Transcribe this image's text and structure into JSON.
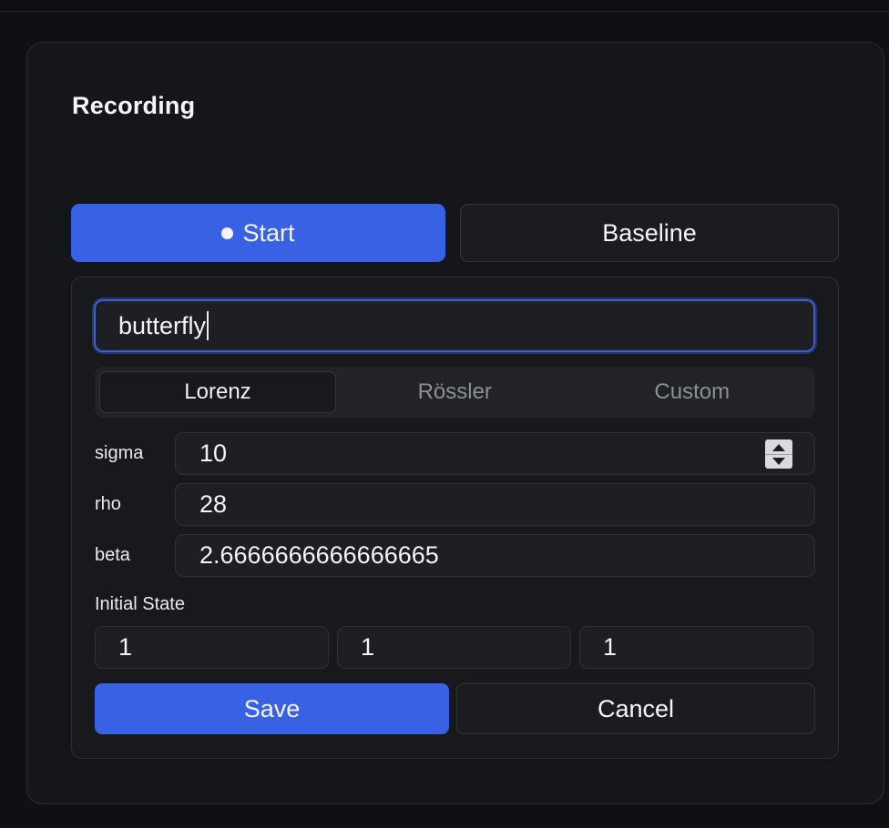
{
  "panel": {
    "title": "Recording"
  },
  "mode_buttons": {
    "start_label": "Start",
    "baseline_label": "Baseline"
  },
  "name_input": {
    "value": "butterfly"
  },
  "system_tabs": [
    {
      "label": "Lorenz",
      "active": true
    },
    {
      "label": "Rössler",
      "active": false
    },
    {
      "label": "Custom",
      "active": false
    }
  ],
  "params": [
    {
      "label": "sigma",
      "value": "10"
    },
    {
      "label": "rho",
      "value": "28"
    },
    {
      "label": "beta",
      "value": "2.6666666666666665"
    }
  ],
  "initial_state": {
    "label": "Initial State",
    "values": [
      "1",
      "1",
      "1"
    ]
  },
  "actions": {
    "save_label": "Save",
    "cancel_label": "Cancel"
  },
  "colors": {
    "accent": "#3862e3",
    "background": "#0e1013",
    "panel": "#141619",
    "focus_ring": "#3d5fcf"
  },
  "icons": {
    "start_indicator": "record-dot-icon",
    "stepper": "number-stepper-icon"
  }
}
